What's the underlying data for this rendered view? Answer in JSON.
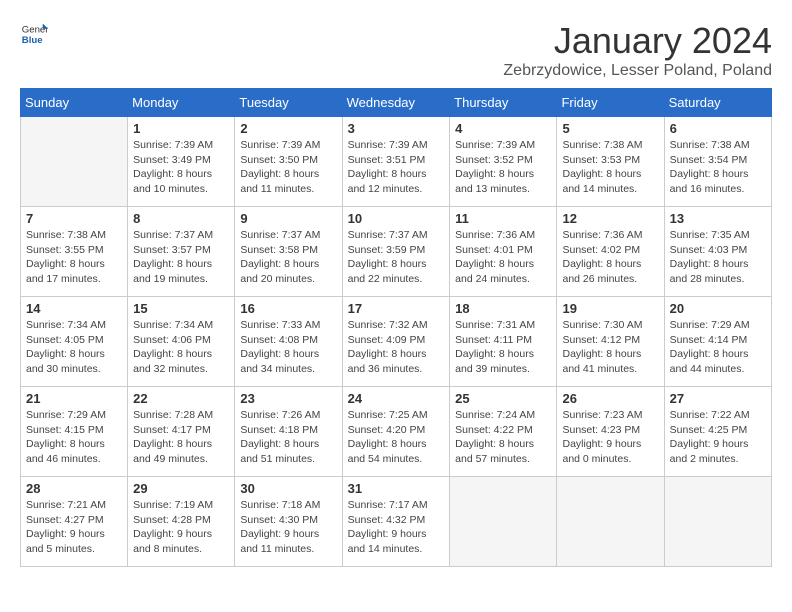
{
  "header": {
    "logo_general": "General",
    "logo_blue": "Blue",
    "title": "January 2024",
    "subtitle": "Zebrzydowice, Lesser Poland, Poland"
  },
  "weekdays": [
    "Sunday",
    "Monday",
    "Tuesday",
    "Wednesday",
    "Thursday",
    "Friday",
    "Saturday"
  ],
  "weeks": [
    [
      {
        "day": "",
        "info": ""
      },
      {
        "day": "1",
        "info": "Sunrise: 7:39 AM\nSunset: 3:49 PM\nDaylight: 8 hours\nand 10 minutes."
      },
      {
        "day": "2",
        "info": "Sunrise: 7:39 AM\nSunset: 3:50 PM\nDaylight: 8 hours\nand 11 minutes."
      },
      {
        "day": "3",
        "info": "Sunrise: 7:39 AM\nSunset: 3:51 PM\nDaylight: 8 hours\nand 12 minutes."
      },
      {
        "day": "4",
        "info": "Sunrise: 7:39 AM\nSunset: 3:52 PM\nDaylight: 8 hours\nand 13 minutes."
      },
      {
        "day": "5",
        "info": "Sunrise: 7:38 AM\nSunset: 3:53 PM\nDaylight: 8 hours\nand 14 minutes."
      },
      {
        "day": "6",
        "info": "Sunrise: 7:38 AM\nSunset: 3:54 PM\nDaylight: 8 hours\nand 16 minutes."
      }
    ],
    [
      {
        "day": "7",
        "info": "Sunrise: 7:38 AM\nSunset: 3:55 PM\nDaylight: 8 hours\nand 17 minutes."
      },
      {
        "day": "8",
        "info": "Sunrise: 7:37 AM\nSunset: 3:57 PM\nDaylight: 8 hours\nand 19 minutes."
      },
      {
        "day": "9",
        "info": "Sunrise: 7:37 AM\nSunset: 3:58 PM\nDaylight: 8 hours\nand 20 minutes."
      },
      {
        "day": "10",
        "info": "Sunrise: 7:37 AM\nSunset: 3:59 PM\nDaylight: 8 hours\nand 22 minutes."
      },
      {
        "day": "11",
        "info": "Sunrise: 7:36 AM\nSunset: 4:01 PM\nDaylight: 8 hours\nand 24 minutes."
      },
      {
        "day": "12",
        "info": "Sunrise: 7:36 AM\nSunset: 4:02 PM\nDaylight: 8 hours\nand 26 minutes."
      },
      {
        "day": "13",
        "info": "Sunrise: 7:35 AM\nSunset: 4:03 PM\nDaylight: 8 hours\nand 28 minutes."
      }
    ],
    [
      {
        "day": "14",
        "info": "Sunrise: 7:34 AM\nSunset: 4:05 PM\nDaylight: 8 hours\nand 30 minutes."
      },
      {
        "day": "15",
        "info": "Sunrise: 7:34 AM\nSunset: 4:06 PM\nDaylight: 8 hours\nand 32 minutes."
      },
      {
        "day": "16",
        "info": "Sunrise: 7:33 AM\nSunset: 4:08 PM\nDaylight: 8 hours\nand 34 minutes."
      },
      {
        "day": "17",
        "info": "Sunrise: 7:32 AM\nSunset: 4:09 PM\nDaylight: 8 hours\nand 36 minutes."
      },
      {
        "day": "18",
        "info": "Sunrise: 7:31 AM\nSunset: 4:11 PM\nDaylight: 8 hours\nand 39 minutes."
      },
      {
        "day": "19",
        "info": "Sunrise: 7:30 AM\nSunset: 4:12 PM\nDaylight: 8 hours\nand 41 minutes."
      },
      {
        "day": "20",
        "info": "Sunrise: 7:29 AM\nSunset: 4:14 PM\nDaylight: 8 hours\nand 44 minutes."
      }
    ],
    [
      {
        "day": "21",
        "info": "Sunrise: 7:29 AM\nSunset: 4:15 PM\nDaylight: 8 hours\nand 46 minutes."
      },
      {
        "day": "22",
        "info": "Sunrise: 7:28 AM\nSunset: 4:17 PM\nDaylight: 8 hours\nand 49 minutes."
      },
      {
        "day": "23",
        "info": "Sunrise: 7:26 AM\nSunset: 4:18 PM\nDaylight: 8 hours\nand 51 minutes."
      },
      {
        "day": "24",
        "info": "Sunrise: 7:25 AM\nSunset: 4:20 PM\nDaylight: 8 hours\nand 54 minutes."
      },
      {
        "day": "25",
        "info": "Sunrise: 7:24 AM\nSunset: 4:22 PM\nDaylight: 8 hours\nand 57 minutes."
      },
      {
        "day": "26",
        "info": "Sunrise: 7:23 AM\nSunset: 4:23 PM\nDaylight: 9 hours\nand 0 minutes."
      },
      {
        "day": "27",
        "info": "Sunrise: 7:22 AM\nSunset: 4:25 PM\nDaylight: 9 hours\nand 2 minutes."
      }
    ],
    [
      {
        "day": "28",
        "info": "Sunrise: 7:21 AM\nSunset: 4:27 PM\nDaylight: 9 hours\nand 5 minutes."
      },
      {
        "day": "29",
        "info": "Sunrise: 7:19 AM\nSunset: 4:28 PM\nDaylight: 9 hours\nand 8 minutes."
      },
      {
        "day": "30",
        "info": "Sunrise: 7:18 AM\nSunset: 4:30 PM\nDaylight: 9 hours\nand 11 minutes."
      },
      {
        "day": "31",
        "info": "Sunrise: 7:17 AM\nSunset: 4:32 PM\nDaylight: 9 hours\nand 14 minutes."
      },
      {
        "day": "",
        "info": ""
      },
      {
        "day": "",
        "info": ""
      },
      {
        "day": "",
        "info": ""
      }
    ]
  ]
}
